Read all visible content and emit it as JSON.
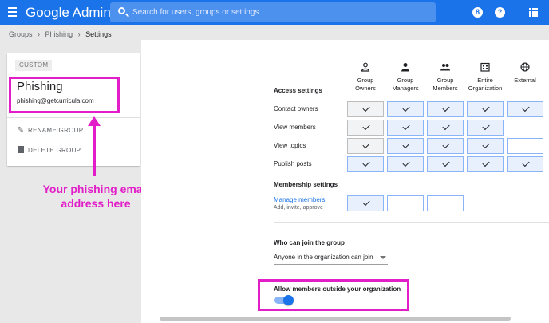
{
  "app": {
    "title": "Google Admin"
  },
  "search": {
    "placeholder": "Search for users, groups or settings"
  },
  "topbar_icons": [
    "account-circle-icon",
    "help-icon",
    "apps-grid-icon"
  ],
  "breadcrumb": [
    "Groups",
    "Phishing",
    "Settings"
  ],
  "group": {
    "badge": "CUSTOM",
    "name": "Phishing",
    "email": "phishing@getcurricula.com",
    "actions": [
      {
        "label": "RENAME GROUP",
        "icon": "pencil-icon"
      },
      {
        "label": "DELETE GROUP",
        "icon": "trash-icon"
      }
    ]
  },
  "annotation": {
    "line1": "Your phishing email",
    "line2": "address here"
  },
  "access": {
    "title": "Access settings",
    "columns": [
      {
        "line1": "Group",
        "line2": "Owners",
        "icon": "person-outline-icon"
      },
      {
        "line1": "Group",
        "line2": "Managers",
        "icon": "person-icon"
      },
      {
        "line1": "Group",
        "line2": "Members",
        "icon": "people-icon"
      },
      {
        "line1": "Entire",
        "line2": "Organization",
        "icon": "building-icon"
      },
      {
        "line1": "External",
        "line2": "",
        "icon": "globe-icon"
      }
    ],
    "rows": [
      {
        "label": "Contact owners",
        "cells": [
          "checked-grey",
          "checked",
          "checked",
          "checked",
          "checked"
        ]
      },
      {
        "label": "View members",
        "cells": [
          "checked-grey",
          "checked",
          "checked",
          "checked",
          "none"
        ]
      },
      {
        "label": "View topics",
        "cells": [
          "checked-grey",
          "checked",
          "checked",
          "checked",
          "empty"
        ]
      },
      {
        "label": "Publish posts",
        "cells": [
          "checked",
          "checked",
          "checked",
          "checked",
          "checked"
        ]
      }
    ]
  },
  "membership": {
    "title": "Membership settings",
    "link": "Manage members",
    "sub": "Add, invite, approve",
    "cells": [
      "checked",
      "empty",
      "empty"
    ]
  },
  "join": {
    "title": "Who can join the group",
    "value": "Anyone in the organization can join"
  },
  "outside": {
    "title": "Allow members outside your organization",
    "enabled": true
  },
  "colors": {
    "accent": "#1a73e8",
    "highlight": "#e21ec8"
  }
}
